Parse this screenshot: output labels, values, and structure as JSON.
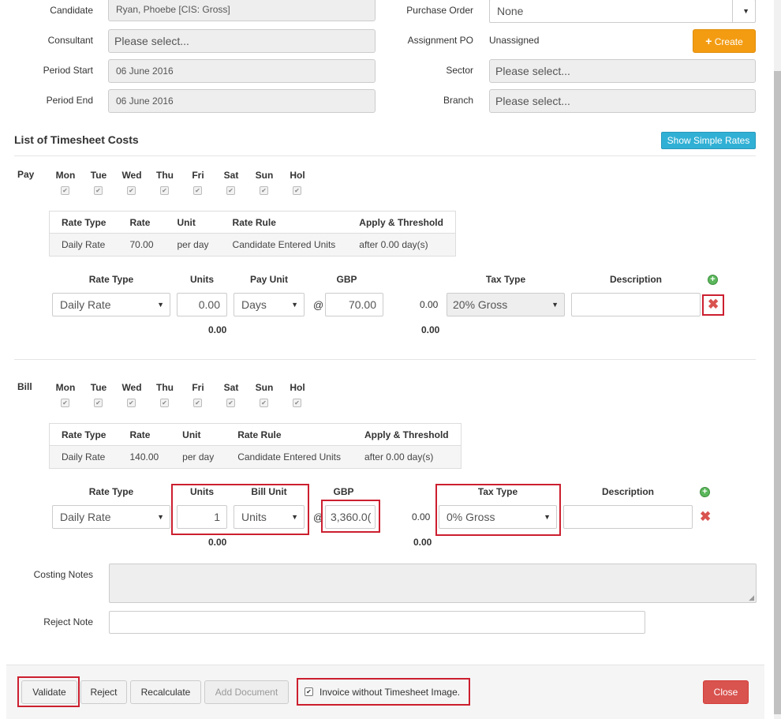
{
  "top": {
    "candidate_label": "Candidate",
    "candidate_value": "Ryan, Phoebe [CIS: Gross]",
    "consultant_label": "Consultant",
    "consultant_placeholder": "Please select...",
    "period_start_label": "Period Start",
    "period_start_value": "06 June 2016",
    "period_end_label": "Period End",
    "period_end_value": "06 June 2016",
    "purchase_order_label": "Purchase Order",
    "purchase_order_value": "None",
    "assignment_po_label": "Assignment PO",
    "assignment_po_value": "Unassigned",
    "create_label": "Create",
    "sector_label": "Sector",
    "sector_placeholder": "Please select...",
    "branch_label": "Branch",
    "branch_placeholder": "Please select..."
  },
  "costs": {
    "title": "List of Timesheet Costs",
    "simple_rates_label": "Show Simple Rates"
  },
  "days": [
    "Mon",
    "Tue",
    "Wed",
    "Thu",
    "Fri",
    "Sat",
    "Sun",
    "Hol"
  ],
  "pay": {
    "section_label": "Pay",
    "table_headers": [
      "Rate Type",
      "Rate",
      "Unit",
      "Rate Rule",
      "Apply & Threshold"
    ],
    "table_row": [
      "Daily Rate",
      "70.00",
      "per day",
      "Candidate Entered Units",
      "after 0.00 day(s)"
    ],
    "col_rate_type": "Rate Type",
    "col_units": "Units",
    "col_unit": "Pay Unit",
    "col_currency": "GBP",
    "col_tax_type": "Tax Type",
    "col_description": "Description",
    "rate_type_value": "Daily Rate",
    "units_value": "0.00",
    "unit_value": "Days",
    "at": "@",
    "gbp_value": "70.00",
    "amount": "0.00",
    "tax_type_value": "20% Gross",
    "units_total": "0.00",
    "tax_total": "0.00"
  },
  "bill": {
    "section_label": "Bill",
    "table_headers": [
      "Rate Type",
      "Rate",
      "Unit",
      "Rate Rule",
      "Apply & Threshold"
    ],
    "table_row": [
      "Daily Rate",
      "140.00",
      "per day",
      "Candidate Entered Units",
      "after 0.00 day(s)"
    ],
    "col_rate_type": "Rate Type",
    "col_units": "Units",
    "col_unit": "Bill Unit",
    "col_currency": "GBP",
    "col_tax_type": "Tax Type",
    "col_description": "Description",
    "rate_type_value": "Daily Rate",
    "units_value": "1",
    "unit_value": "Units",
    "at": "@",
    "gbp_value": "3,360.0(",
    "amount": "0.00",
    "tax_type_value": "0% Gross",
    "units_total": "0.00",
    "tax_total": "0.00"
  },
  "notes": {
    "costing_label": "Costing Notes",
    "reject_label": "Reject Note"
  },
  "footer": {
    "validate": "Validate",
    "reject": "Reject",
    "recalculate": "Recalculate",
    "add_document": "Add Document",
    "invoice_without_image": "Invoice without Timesheet Image.",
    "close": "Close"
  },
  "colors": {
    "create": "#f39c12",
    "simple_rates": "#31b0d5",
    "close": "#d9534f",
    "highlight": "#cc1f2f"
  }
}
